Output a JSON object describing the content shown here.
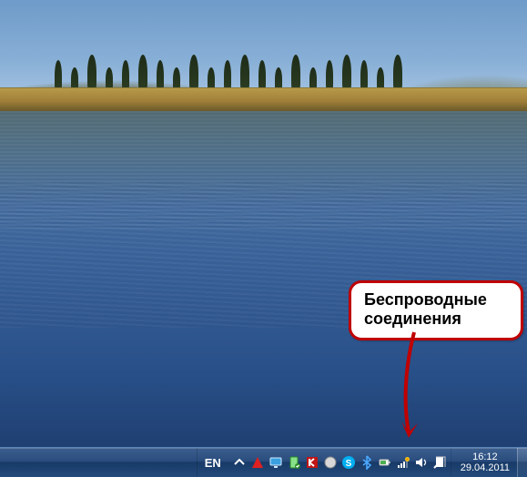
{
  "callout": {
    "line1": "Беспроводные",
    "line2": "соединения"
  },
  "taskbar": {
    "language": "EN",
    "clock": {
      "time": "16:12",
      "date": "29.04.2011"
    },
    "tray_icons": [
      {
        "name": "show-hidden-icons-icon",
        "title": "Показать скрытые значки"
      },
      {
        "name": "app-utility-icon",
        "title": "Утилита"
      },
      {
        "name": "display-settings-icon",
        "title": "Экран"
      },
      {
        "name": "safely-remove-hardware-icon",
        "title": "Безопасное извлечение устройств"
      },
      {
        "name": "kaspersky-icon",
        "title": "Антивирус"
      },
      {
        "name": "app-generic-icon",
        "title": "Приложение"
      },
      {
        "name": "skype-icon",
        "title": "Skype"
      },
      {
        "name": "bluetooth-icon",
        "title": "Bluetooth"
      },
      {
        "name": "power-icon",
        "title": "Питание"
      },
      {
        "name": "network-wireless-icon",
        "title": "Беспроводные соединения"
      },
      {
        "name": "volume-icon",
        "title": "Громкость"
      },
      {
        "name": "action-center-icon",
        "title": "Центр поддержки"
      }
    ]
  }
}
